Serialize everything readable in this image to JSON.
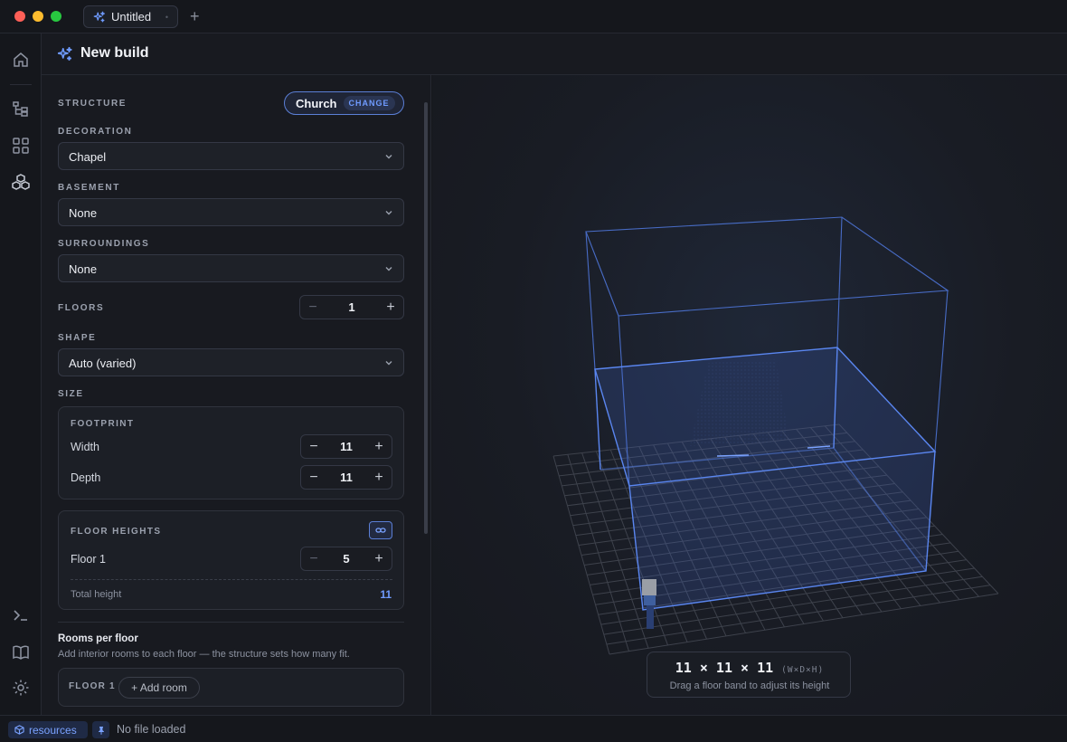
{
  "window": {
    "tab_title": "Untitled",
    "tab_close": "•",
    "new_tab": "+"
  },
  "header": {
    "title": "New build",
    "icon": "sparkles-icon"
  },
  "form": {
    "structure": {
      "label": "STRUCTURE",
      "value": "Church",
      "change_label": "CHANGE"
    },
    "decoration": {
      "label": "DECORATION",
      "value": "Chapel"
    },
    "basement": {
      "label": "BASEMENT",
      "value": "None"
    },
    "surroundings": {
      "label": "SURROUNDINGS",
      "value": "None"
    },
    "floors": {
      "label": "FLOORS",
      "value": "1",
      "minus": "−",
      "plus": "+"
    },
    "shape": {
      "label": "SHAPE",
      "value": "Auto (varied)"
    },
    "size": {
      "label": "SIZE"
    },
    "footprint": {
      "label": "FOOTPRINT",
      "width_label": "Width",
      "width_value": "11",
      "depth_label": "Depth",
      "depth_value": "11"
    },
    "floor_heights": {
      "label": "FLOOR HEIGHTS",
      "floor_label": "Floor 1",
      "floor_value": "5",
      "total_label": "Total height",
      "total_value": "11"
    },
    "rooms": {
      "title": "Rooms per floor",
      "subtitle": "Add interior rooms to each floor — the structure sets how many fit.",
      "floor_label": "FLOOR 1",
      "add_label": "+ Add room"
    }
  },
  "viewport": {
    "dimensions": "11 × 11 × 11",
    "dimensions_unit": "(W×D×H)",
    "hint": "Drag a floor band to adjust its height"
  },
  "status": {
    "resources_label": "resources",
    "file_status": "No file loaded"
  },
  "colors": {
    "accent": "#6f9bff",
    "traffic_red": "#fe5f57",
    "traffic_yellow": "#febc2e",
    "traffic_green": "#28c840"
  }
}
